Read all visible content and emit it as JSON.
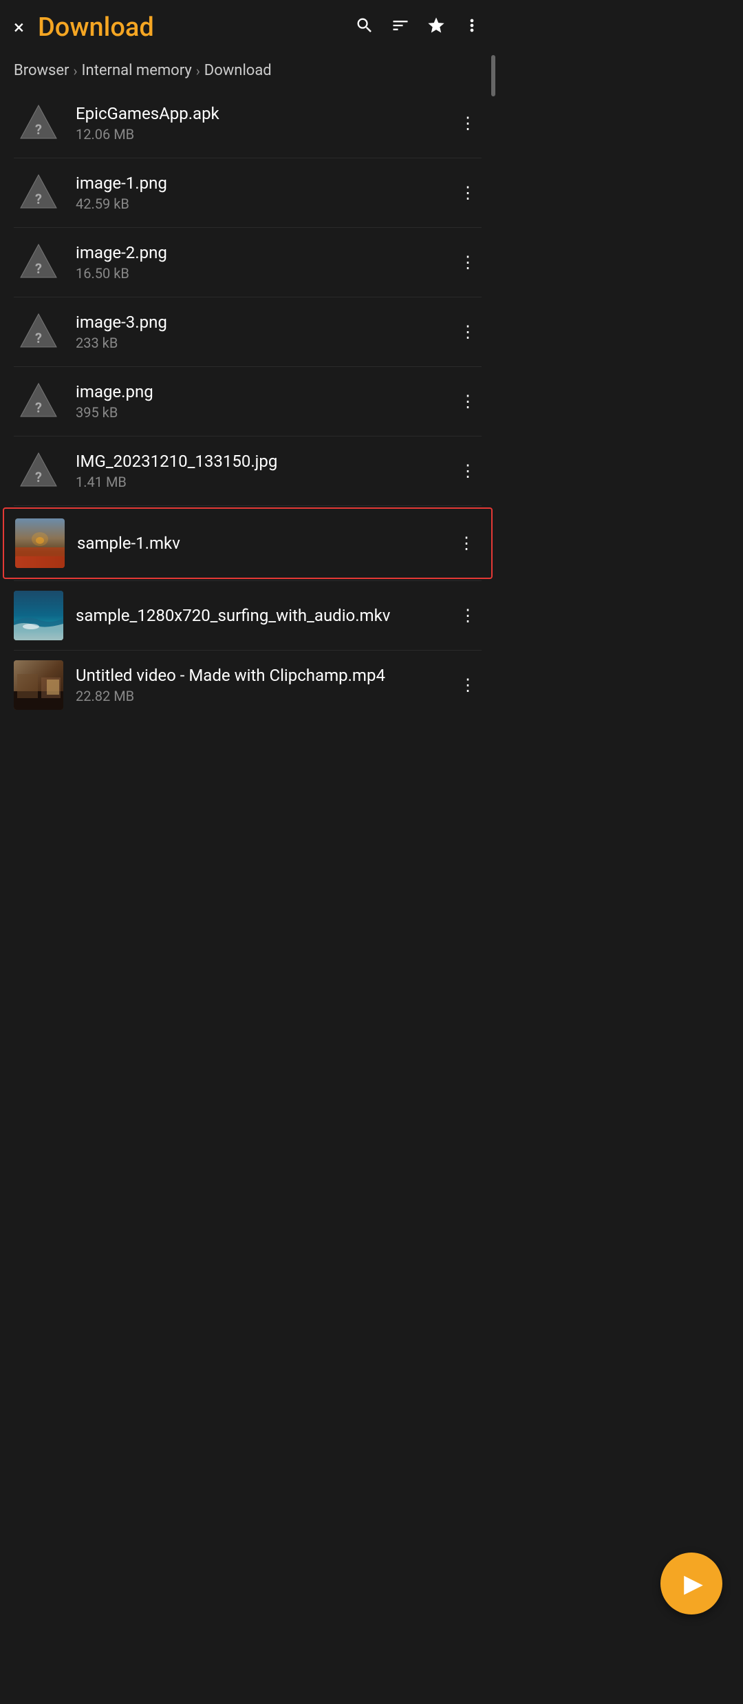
{
  "header": {
    "title": "Download",
    "close_label": "×",
    "icons": {
      "search": "search-icon",
      "filter": "filter-icon",
      "star": "star-icon",
      "more": "more-icon"
    }
  },
  "breadcrumb": {
    "items": [
      {
        "label": "Browser",
        "id": "browser"
      },
      {
        "label": "Internal memory",
        "id": "internal-memory"
      },
      {
        "label": "Download",
        "id": "download"
      }
    ],
    "separators": [
      "›",
      "›"
    ]
  },
  "files": [
    {
      "id": "file-1",
      "name": "EpicGamesApp.apk",
      "size": "12.06 MB",
      "type": "unknown",
      "selected": false
    },
    {
      "id": "file-2",
      "name": "image-1.png",
      "size": "42.59 kB",
      "type": "unknown",
      "selected": false
    },
    {
      "id": "file-3",
      "name": "image-2.png",
      "size": "16.50 kB",
      "type": "unknown",
      "selected": false
    },
    {
      "id": "file-4",
      "name": "image-3.png",
      "size": "233 kB",
      "type": "unknown",
      "selected": false
    },
    {
      "id": "file-5",
      "name": "image.png",
      "size": "395 kB",
      "type": "unknown",
      "selected": false
    },
    {
      "id": "file-6",
      "name": "IMG_20231210_133150.jpg",
      "size": "1.41 MB",
      "type": "unknown",
      "selected": false
    },
    {
      "id": "file-7",
      "name": "sample-1.mkv",
      "size": "",
      "type": "video-sample1",
      "selected": true
    },
    {
      "id": "file-8",
      "name": "sample_1280x720_surfing_with_audio.mkv",
      "size": "",
      "type": "video-surfing",
      "selected": false
    },
    {
      "id": "file-9",
      "name": "Untitled video - Made with Clipchamp.mp4",
      "size": "22.82 MB",
      "type": "video-clipchamp",
      "selected": false
    }
  ],
  "fab": {
    "label": "▶"
  },
  "colors": {
    "accent": "#f5a623",
    "selected_border": "#e53935",
    "background": "#1a1a1a",
    "text_primary": "#ffffff",
    "text_secondary": "#888888"
  }
}
